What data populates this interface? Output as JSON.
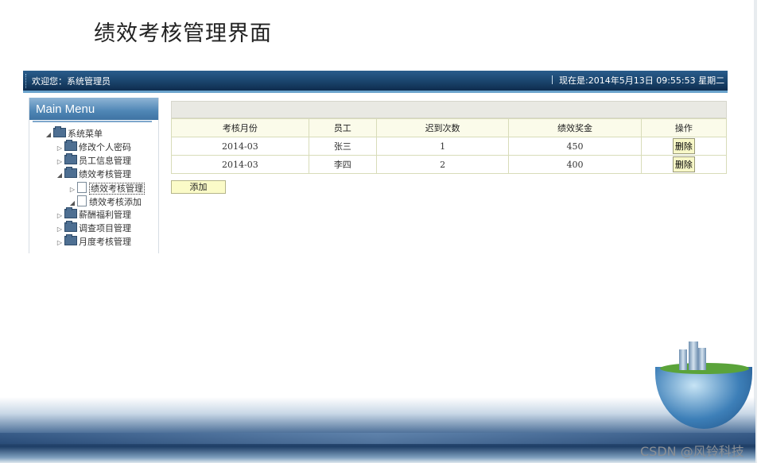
{
  "page_title": "绩效考核管理界面",
  "header": {
    "welcome": "欢迎您：系统管理员",
    "clock": "现在是:2014年5月13日  09:55:53 星期二"
  },
  "sidebar": {
    "title": "Main Menu",
    "root": "系统菜单",
    "items": [
      {
        "label": "修改个人密码"
      },
      {
        "label": "员工信息管理"
      },
      {
        "label": "绩效考核管理"
      },
      {
        "label": "绩效考核管理"
      },
      {
        "label": "绩效考核添加"
      },
      {
        "label": "薪酬福利管理"
      },
      {
        "label": "调查项目管理"
      },
      {
        "label": "月度考核管理"
      }
    ]
  },
  "table": {
    "columns": [
      "考核月份",
      "员工",
      "迟到次数",
      "绩效奖金",
      "操作"
    ],
    "rows": [
      {
        "month": "2014-03",
        "employee": "张三",
        "late": "1",
        "bonus": "450",
        "action": "删除"
      },
      {
        "month": "2014-03",
        "employee": "李四",
        "late": "2",
        "bonus": "400",
        "action": "删除"
      }
    ]
  },
  "add_button": "添加",
  "watermark": "CSDN @风铃科技"
}
